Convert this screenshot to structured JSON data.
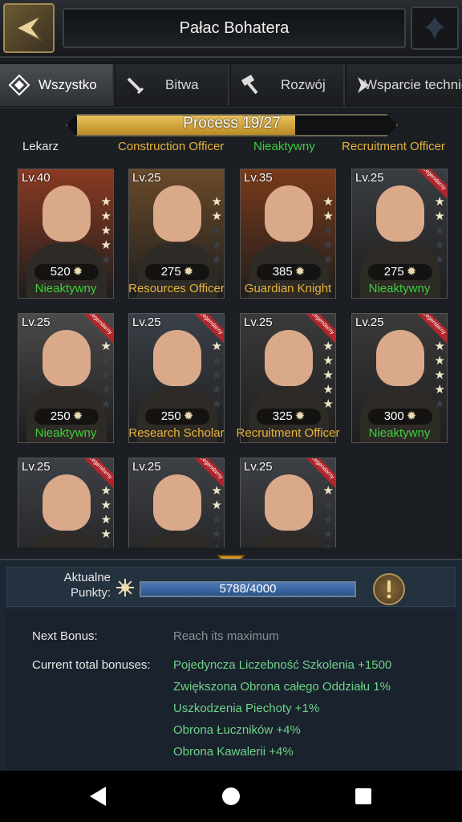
{
  "header": {
    "title": "Pałac Bohatera"
  },
  "tabs": [
    {
      "label": "Wszystko",
      "icon": "diamond-icon",
      "active": true
    },
    {
      "label": "Bitwa",
      "icon": "sword-icon",
      "active": false
    },
    {
      "label": "Rozwój",
      "icon": "hammer-icon",
      "active": false
    },
    {
      "label": "Wsparcie technic",
      "icon": "support-icon",
      "active": false
    }
  ],
  "progress": {
    "text": "Process 19/27",
    "value": 0.7037
  },
  "cut_row": [
    "Lekarz",
    "Construction Officer",
    "Nieaktywny",
    "Recruitment Officer"
  ],
  "heroes": [
    {
      "level": "Lv.40",
      "power": "520",
      "role": "Nieaktywny",
      "role_color": "green",
      "stars": 4,
      "legendary": false,
      "bg": "#8a3a22"
    },
    {
      "level": "Lv.25",
      "power": "275",
      "role": "Resources Officer",
      "role_color": "gold",
      "stars": 2,
      "legendary": false,
      "bg": "#6a4a2a"
    },
    {
      "level": "Lv.35",
      "power": "385",
      "role": "Guardian Knight",
      "role_color": "gold",
      "stars": 2,
      "legendary": false,
      "bg": "#7a3a1a"
    },
    {
      "level": "Lv.25",
      "power": "275",
      "role": "Nieaktywny",
      "role_color": "green",
      "stars": 2,
      "legendary": true,
      "legend_text": "Legendarny",
      "bg": "#3a3d42"
    },
    {
      "level": "Lv.25",
      "power": "250",
      "role": "Nieaktywny",
      "role_color": "green",
      "stars": 1,
      "legendary": true,
      "legend_text": "Legendarny",
      "bg": "#4a4a4a"
    },
    {
      "level": "Lv.25",
      "power": "250",
      "role": "Research Scholar",
      "role_color": "gold",
      "stars": 1,
      "legendary": true,
      "legend_text": "Legendarny",
      "bg": "#3a4048"
    },
    {
      "level": "Lv.25",
      "power": "325",
      "role": "Recruitment Officer",
      "role_color": "gold",
      "stars": 5,
      "legendary": true,
      "legend_text": "Legendarny",
      "bg": "#3a3a3a"
    },
    {
      "level": "Lv.25",
      "power": "300",
      "role": "Nieaktywny",
      "role_color": "green",
      "stars": 4,
      "legendary": true,
      "legend_text": "Legendarny",
      "bg": "#3a3a3a"
    },
    {
      "level": "Lv.25",
      "power": "",
      "role": "",
      "role_color": "green",
      "stars": 4,
      "legendary": true,
      "legend_text": "Legendarny",
      "bg": "#3d4046"
    },
    {
      "level": "Lv.25",
      "power": "",
      "role": "",
      "role_color": "green",
      "stars": 2,
      "legendary": true,
      "legend_text": "Legendarny",
      "bg": "#3d4046"
    },
    {
      "level": "Lv.25",
      "power": "",
      "role": "",
      "role_color": "green",
      "stars": 1,
      "legendary": true,
      "legend_text": "Legendarny",
      "bg": "#3d4046"
    }
  ],
  "points": {
    "label": "Aktualne Punkty:",
    "text": "5788/4000",
    "value": 1.0
  },
  "bonus": {
    "next_label": "Next Bonus:",
    "next_value": "Reach its maximum",
    "current_label": "Current total bonuses:",
    "items": [
      "Pojedyncza Liczebność Szkolenia +1500",
      "Zwiększona Obrona całego Oddziału 1%",
      "Uszkodzenia Piechoty +1%",
      "Obrona Łuczników +4%",
      "Obrona Kawalerii +4%"
    ]
  },
  "colors": {
    "accent_gold": "#e6b33a",
    "active_green": "#3fcf3f",
    "bonus_green": "#6fd38a",
    "legendary_red": "#b0262a"
  }
}
